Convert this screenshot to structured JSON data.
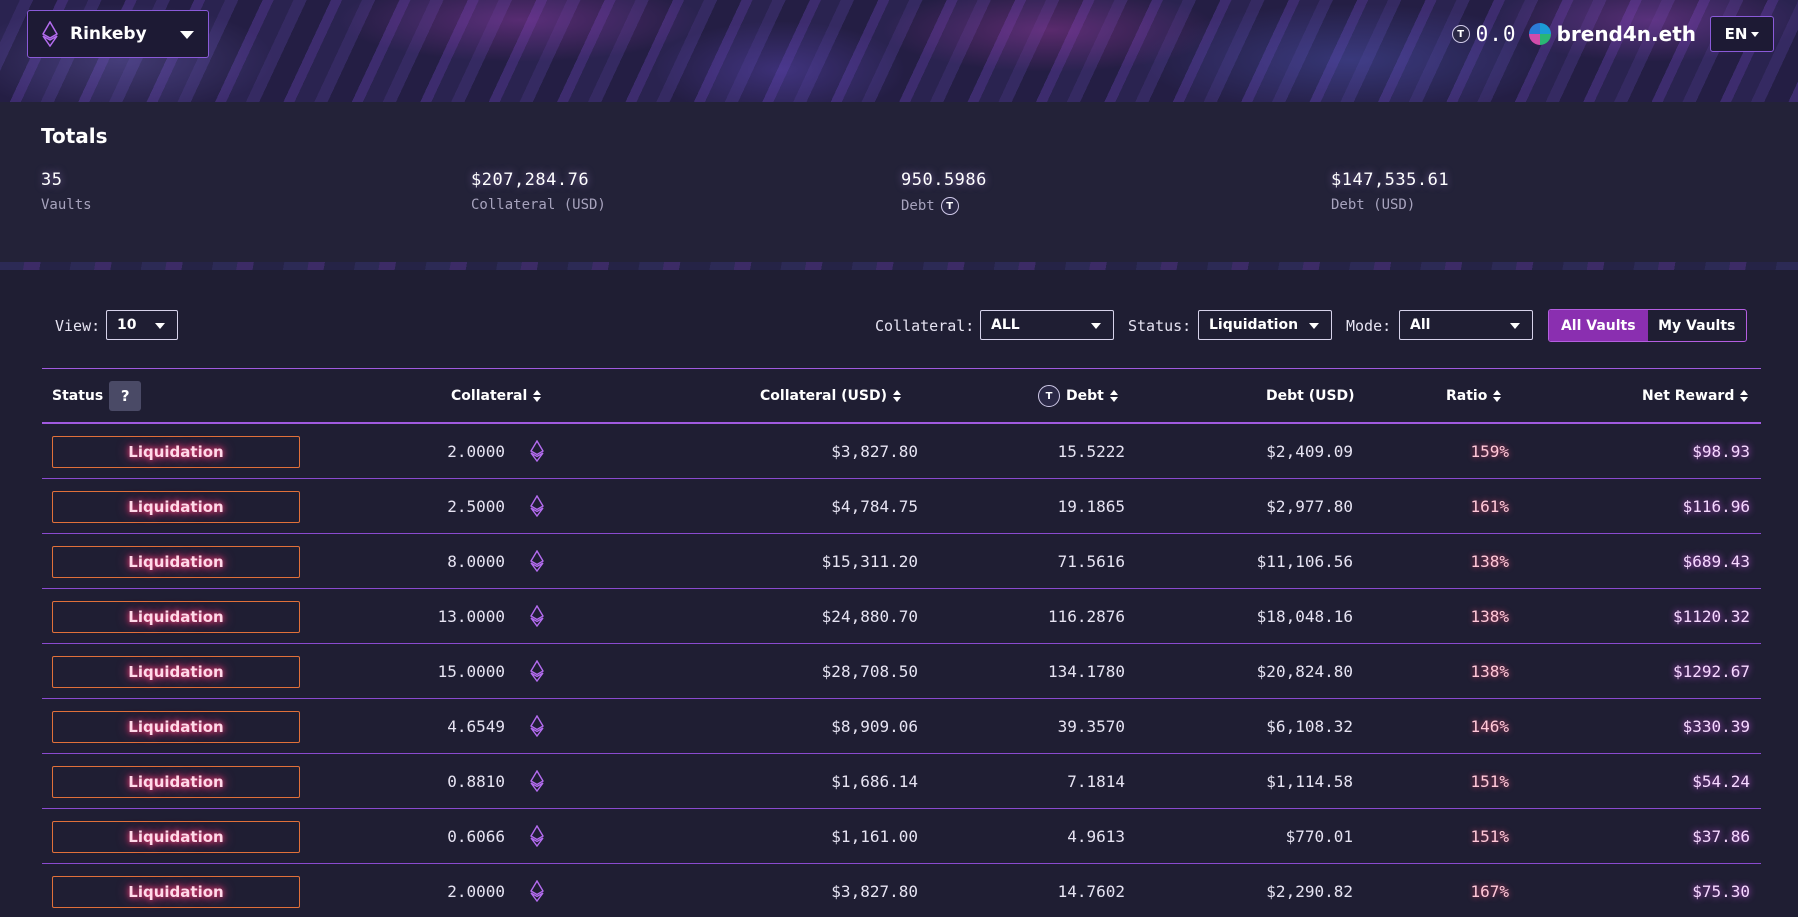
{
  "network": {
    "name": "Rinkeby",
    "icon": "ethereum-icon"
  },
  "account": {
    "token_icon": "tcap-icon",
    "token_letter": "T",
    "balance": "0.0",
    "ens": "brend4n.eth"
  },
  "language": {
    "label": "EN"
  },
  "totals": {
    "title": "Totals",
    "vaults": {
      "value": "35",
      "label": "Vaults"
    },
    "collateral_usd": {
      "value": "$207,284.76",
      "label": "Collateral (USD)"
    },
    "debt": {
      "value": "950.5986",
      "label": "Debt"
    },
    "debt_usd": {
      "value": "$147,535.61",
      "label": "Debt (USD)"
    }
  },
  "controls": {
    "view_label": "View:",
    "view_value": "10",
    "collateral_label": "Collateral:",
    "collateral_value": "ALL",
    "status_label": "Status:",
    "status_value": "Liquidation",
    "mode_label": "Mode:",
    "mode_value": "All",
    "toggle": [
      "All Vaults",
      "My Vaults"
    ],
    "toggle_active": "All Vaults"
  },
  "table": {
    "headers": {
      "status": "Status",
      "help": "?",
      "collateral": "Collateral",
      "collateral_usd": "Collateral (USD)",
      "debt": "Debt",
      "debt_usd": "Debt (USD)",
      "ratio": "Ratio",
      "net_reward": "Net Reward"
    },
    "rows": [
      {
        "status": "Liquidation",
        "collateral": "2.0000",
        "collateral_usd": "$3,827.80",
        "debt": "15.5222",
        "debt_usd": "$2,409.09",
        "ratio": "159%",
        "net_reward": "$98.93"
      },
      {
        "status": "Liquidation",
        "collateral": "2.5000",
        "collateral_usd": "$4,784.75",
        "debt": "19.1865",
        "debt_usd": "$2,977.80",
        "ratio": "161%",
        "net_reward": "$116.96"
      },
      {
        "status": "Liquidation",
        "collateral": "8.0000",
        "collateral_usd": "$15,311.20",
        "debt": "71.5616",
        "debt_usd": "$11,106.56",
        "ratio": "138%",
        "net_reward": "$689.43"
      },
      {
        "status": "Liquidation",
        "collateral": "13.0000",
        "collateral_usd": "$24,880.70",
        "debt": "116.2876",
        "debt_usd": "$18,048.16",
        "ratio": "138%",
        "net_reward": "$1120.32"
      },
      {
        "status": "Liquidation",
        "collateral": "15.0000",
        "collateral_usd": "$28,708.50",
        "debt": "134.1780",
        "debt_usd": "$20,824.80",
        "ratio": "138%",
        "net_reward": "$1292.67"
      },
      {
        "status": "Liquidation",
        "collateral": "4.6549",
        "collateral_usd": "$8,909.06",
        "debt": "39.3570",
        "debt_usd": "$6,108.32",
        "ratio": "146%",
        "net_reward": "$330.39"
      },
      {
        "status": "Liquidation",
        "collateral": "0.8810",
        "collateral_usd": "$1,686.14",
        "debt": "7.1814",
        "debt_usd": "$1,114.58",
        "ratio": "151%",
        "net_reward": "$54.24"
      },
      {
        "status": "Liquidation",
        "collateral": "0.6066",
        "collateral_usd": "$1,161.00",
        "debt": "4.9613",
        "debt_usd": "$770.01",
        "ratio": "151%",
        "net_reward": "$37.86"
      },
      {
        "status": "Liquidation",
        "collateral": "2.0000",
        "collateral_usd": "$3,827.80",
        "debt": "14.7602",
        "debt_usd": "$2,290.82",
        "ratio": "167%",
        "net_reward": "$75.30"
      }
    ]
  },
  "colors": {
    "accent": "#a05ae0",
    "background": "#1f1e33",
    "liquidation_border": "#e0703a",
    "toggle_active": "#8a2fb0"
  }
}
